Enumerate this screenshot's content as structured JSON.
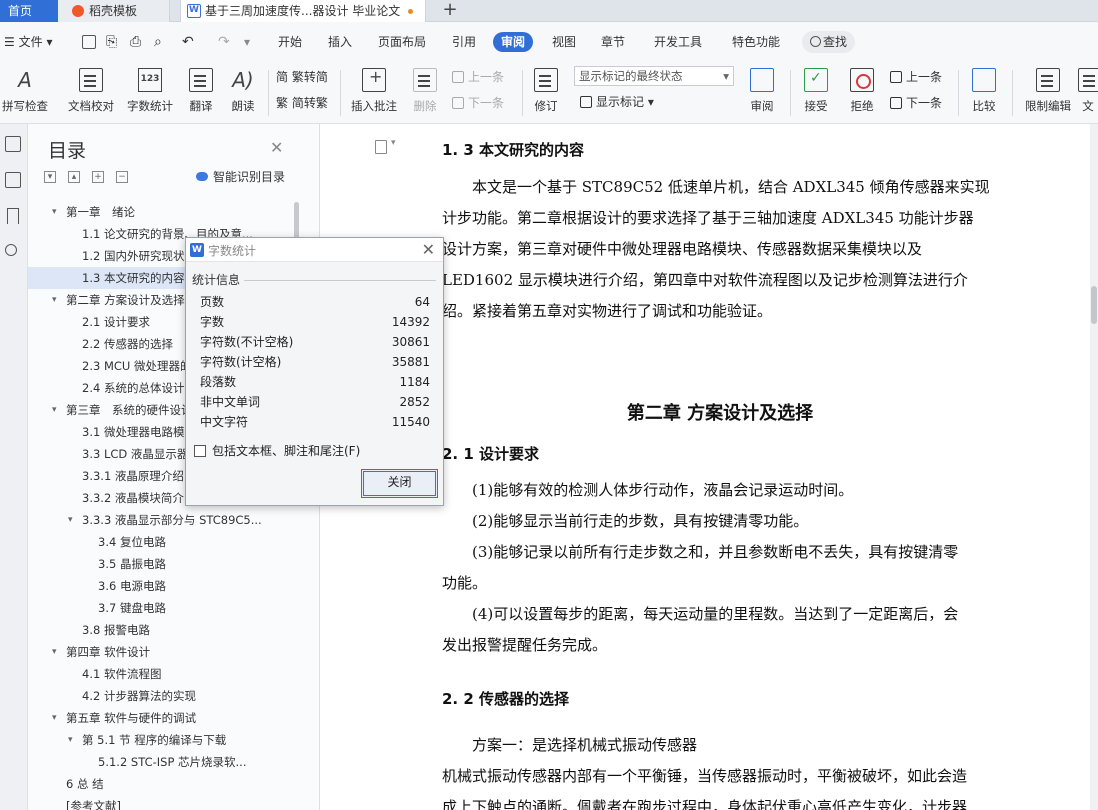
{
  "tabs": {
    "home": "首页",
    "template": "稻壳模板",
    "document": "基于三周加速度传...器设计 毕业论文"
  },
  "menu": {
    "file": "文件",
    "items": [
      "开始",
      "插入",
      "页面布局",
      "引用",
      "审阅",
      "视图",
      "章节",
      "开发工具",
      "特色功能"
    ],
    "active": "审阅",
    "search": "查找"
  },
  "ribbon": {
    "spell_check": "拼写检查",
    "doc_proof": "文档校对",
    "word_count": "字数统计",
    "translate": "翻译",
    "read_aloud": "朗读",
    "to_traditional": "繁转简",
    "to_simplified": "简转繁",
    "insert_comment": "插入批注",
    "delete": "删除",
    "prev_comment": "上一条",
    "next_comment": "下一条",
    "revise": "修订",
    "markup_select": "显示标记的最终状态",
    "show_markup": "显示标记",
    "review": "审阅",
    "accept": "接受",
    "reject": "拒绝",
    "prev_change": "上一条",
    "next_change": "下一条",
    "compare": "比较",
    "restrict_edit": "限制编辑",
    "doc_cut": "文"
  },
  "toc": {
    "title": "目录",
    "smart": "智能识别目录",
    "items": [
      {
        "text": "第一章　绪论",
        "level": 0,
        "caret": "▾"
      },
      {
        "text": "1.1 论文研究的背景、目的及意...",
        "level": 1
      },
      {
        "text": "1.2 国内外研究现状",
        "level": 1
      },
      {
        "text": "1.3 本文研究的内容",
        "level": 1,
        "selected": true
      },
      {
        "text": "第二章  方案设计及选择",
        "level": 0,
        "caret": "▾"
      },
      {
        "text": "2.1 设计要求",
        "level": 1
      },
      {
        "text": "2.2 传感器的选择",
        "level": 1
      },
      {
        "text": "2.3 MCU 微处理器的选择",
        "level": 1
      },
      {
        "text": "2.4 系统的总体设计",
        "level": 1
      },
      {
        "text": "第三章　系统的硬件设计",
        "level": 0,
        "caret": "▾"
      },
      {
        "text": "3.1 微处理器电路模块",
        "level": 1
      },
      {
        "text": "3.3 LCD 液晶显示器",
        "level": 1
      },
      {
        "text": "3.3.1  液晶原理介绍",
        "level": 1
      },
      {
        "text": "3.3.2 液晶模块简介",
        "level": 1
      },
      {
        "text": "3.3.3 液晶显示部分与 STC89C5...",
        "level": 1,
        "caret": "▾"
      },
      {
        "text": "3.4  复位电路",
        "level": 2
      },
      {
        "text": "3.5  晶振电路",
        "level": 2
      },
      {
        "text": "3.6   电源电路",
        "level": 2
      },
      {
        "text": "3.7  键盘电路",
        "level": 2
      },
      {
        "text": "3.8  报警电路",
        "level": 1
      },
      {
        "text": "第四章  软件设计",
        "level": 0,
        "caret": "▾"
      },
      {
        "text": "4.1 软件流程图",
        "level": 1
      },
      {
        "text": "4.2 计步器算法的实现",
        "level": 1
      },
      {
        "text": "第五章   软件与硬件的调试",
        "level": 0,
        "caret": "▾"
      },
      {
        "text": "第 5.1 节    程序的编译与下载",
        "level": 1,
        "caret": "▾"
      },
      {
        "text": "5.1.2    STC-ISP 芯片烧录软...",
        "level": 2
      },
      {
        "text": "6 总  结",
        "level": 0
      },
      {
        "text": "[参考文献]",
        "level": 0
      }
    ]
  },
  "dialog": {
    "title": "字数统计",
    "group": "统计信息",
    "rows": [
      {
        "label": "页数",
        "value": "64"
      },
      {
        "label": "字数",
        "value": "14392"
      },
      {
        "label": "字符数(不计空格)",
        "value": "30861"
      },
      {
        "label": "字符数(计空格)",
        "value": "35881"
      },
      {
        "label": "段落数",
        "value": "1184"
      },
      {
        "label": "非中文单词",
        "value": "2852"
      },
      {
        "label": "中文字符",
        "value": "11540"
      }
    ],
    "checkbox": "包括文本框、脚注和尾注(F)",
    "close": "关闭"
  },
  "document": {
    "h13": "1. 3 本文研究的内容",
    "p1": [
      "　　本文是一个基于 STC89C52 低速单片机，结合 ADXL345 倾角传感器来实现",
      "计步功能。第二章根据设计的要求选择了基于三轴加速度 ADXL345 功能计步器",
      "设计方案，第三章对硬件中微处理器电路模块、传感器数据采集模块以及",
      "LED1602 显示模块进行介绍，第四章中对软件流程图以及记步检测算法进行介",
      "绍。紧接着第五章对实物进行了调试和功能验证。"
    ],
    "chapter2": "第二章  方案设计及选择",
    "h21": "2. 1 设计要求",
    "p2": [
      "　　(1)能够有效的检测人体步行动作，液晶会记录运动时间。",
      "　　(2)能够显示当前行走的步数，具有按键清零功能。",
      "　　(3)能够记录以前所有行走步数之和，并且参数断电不丢失，具有按键清零",
      "功能。",
      "　　(4)可以设置每步的距离，每天运动量的里程数。当达到了一定距离后，会",
      "发出报警提醒任务完成。"
    ],
    "h22": "2. 2 传感器的选择",
    "p3": [
      "　　方案一：是选择机械式振动传感器",
      "机械式振动传感器内部有一个平衡锤，当传感器振动时，平衡被破坏，如此会造",
      "成上下触点的通断。佩戴者在跑步过程中，身体起伏重心高低产生变化，计步器"
    ]
  }
}
